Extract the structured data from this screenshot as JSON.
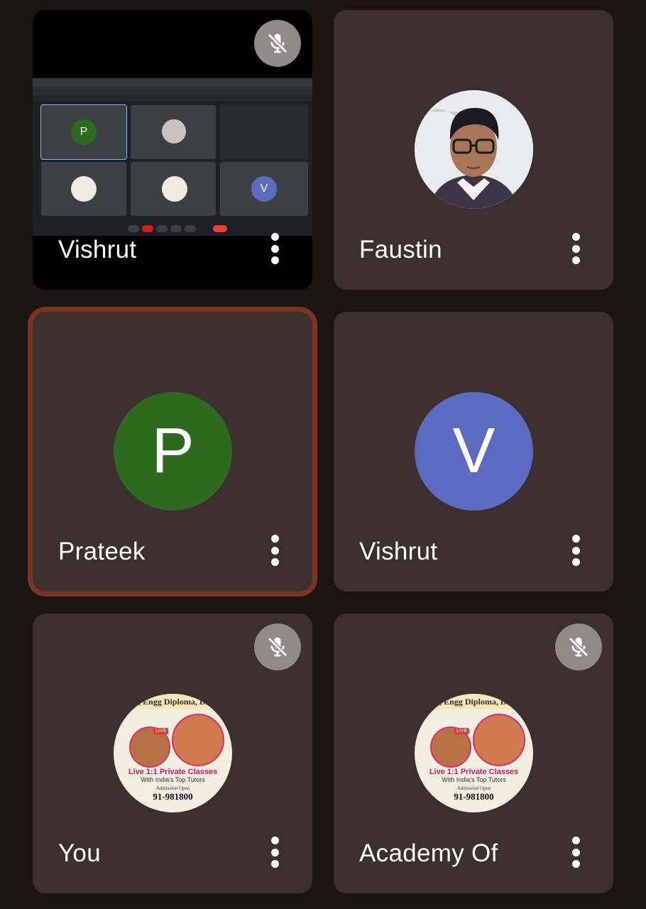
{
  "participants": [
    {
      "name": "Vishrut",
      "muted": true,
      "type": "screen-share"
    },
    {
      "name": "Faustin",
      "muted": false,
      "type": "photo"
    },
    {
      "name": "Prateek",
      "muted": false,
      "type": "initial",
      "initial": "P",
      "color": "#2d6a1e",
      "speaking": true
    },
    {
      "name": "Vishrut",
      "muted": false,
      "type": "initial",
      "initial": "V",
      "color": "#5c6bc0"
    },
    {
      "name": "You",
      "muted": true,
      "type": "logo"
    },
    {
      "name": "Academy Of",
      "muted": true,
      "type": "logo"
    }
  ],
  "logo": {
    "top_text": ", Engg Diploma, B.",
    "headline": "Live 1:1 Private Classes",
    "subline": "With India's Top Tutors",
    "admission": "Admission Open",
    "phone": "91-981800",
    "badge": "LIVE"
  },
  "screen_share": {
    "cells": [
      {
        "initial": "P",
        "color": "#2d6a1e"
      },
      {
        "initial": "",
        "color": ""
      },
      {
        "initial": "",
        "color": ""
      },
      {
        "initial": "",
        "color": ""
      },
      {
        "initial": "",
        "color": ""
      },
      {
        "initial": "V",
        "color": "#5c6bc0"
      }
    ]
  },
  "colors": {
    "background": "#1c1413",
    "tile": "#3b302f",
    "active_border": "#7a3422",
    "mute_badge": "#8f8b8a"
  }
}
